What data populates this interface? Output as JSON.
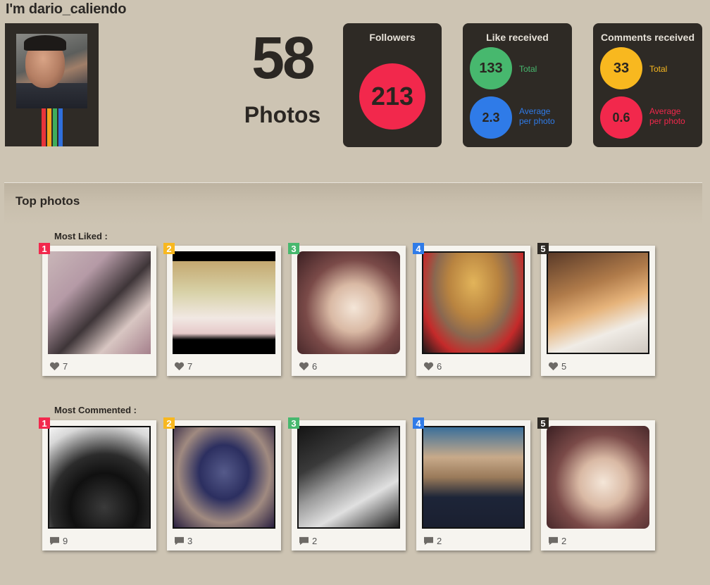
{
  "header": {
    "title": "I'm dario_caliendo"
  },
  "stats": {
    "photos_count": "58",
    "photos_label": "Photos",
    "followers": {
      "title": "Followers",
      "value": "213"
    },
    "likes": {
      "title": "Like received",
      "total_value": "133",
      "total_label": "Total",
      "average_value": "2.3",
      "average_label_line1": "Average",
      "average_label_line2": "per photo"
    },
    "comments": {
      "title": "Comments received",
      "total_value": "33",
      "total_label": "Total",
      "average_value": "0.6",
      "average_label_line1": "Average",
      "average_label_line2": "per photo"
    }
  },
  "colors": {
    "red": "#f2284c",
    "yellow": "#f8b81f",
    "green": "#47b86e",
    "blue": "#2f7be8",
    "dark": "#2e2a25"
  },
  "top_photos": {
    "title": "Top photos",
    "most_liked": {
      "label": "Most Liked :",
      "items": [
        {
          "rank": "1",
          "count": "7"
        },
        {
          "rank": "2",
          "count": "7"
        },
        {
          "rank": "3",
          "count": "6"
        },
        {
          "rank": "4",
          "count": "6"
        },
        {
          "rank": "5",
          "count": "5"
        }
      ]
    },
    "most_commented": {
      "label": "Most Commented :",
      "items": [
        {
          "rank": "1",
          "count": "9"
        },
        {
          "rank": "2",
          "count": "3"
        },
        {
          "rank": "3",
          "count": "2"
        },
        {
          "rank": "4",
          "count": "2"
        },
        {
          "rank": "5",
          "count": "2"
        }
      ]
    }
  }
}
